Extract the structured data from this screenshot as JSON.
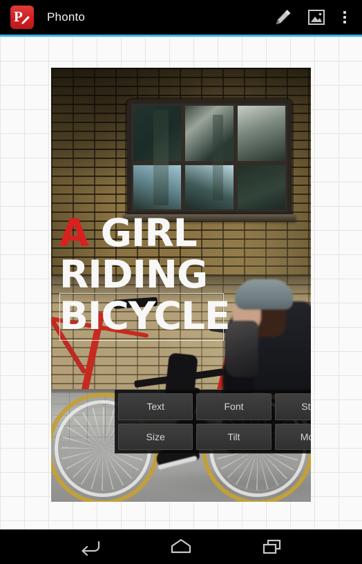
{
  "app": {
    "name": "Phonto",
    "icon_name": "phonto-app-icon",
    "icon_color": "#cf2020"
  },
  "appbar": {
    "title": "Phonto",
    "accent_color": "#33b5e5",
    "background_color": "#000000",
    "actions": [
      {
        "name": "edit-text-icon",
        "label": "Edit"
      },
      {
        "name": "image-icon",
        "label": "Image"
      },
      {
        "name": "overflow-menu-icon",
        "label": "More options"
      }
    ]
  },
  "canvas": {
    "grid_color": "#e4e4e4",
    "background_color": "#fafafa",
    "grid_cell_px": "35"
  },
  "photo": {
    "description": "Woman in dark coat walking past a brick wall with a red bicycle; blurred bicycle in foreground",
    "alt": "brick-wall-cyclist-photo"
  },
  "overlay_text": {
    "line1_accent": "A",
    "line1_rest": " GIRL",
    "line2": "RIDING",
    "line3": "BICYCLE",
    "accent_color": "#d8201f",
    "text_color": "#f7f7f7",
    "selected_line": "BICYCLE"
  },
  "toolbar": {
    "buttons": [
      {
        "name": "text-button",
        "label": "Text"
      },
      {
        "name": "font-button",
        "label": "Font"
      },
      {
        "name": "style-button",
        "label": "Style"
      },
      {
        "name": "size-button",
        "label": "Size"
      },
      {
        "name": "tilt-button",
        "label": "Tilt"
      },
      {
        "name": "move-button",
        "label": "Move"
      }
    ]
  },
  "navbar": {
    "buttons": [
      {
        "name": "back-button",
        "label": "Back"
      },
      {
        "name": "home-button",
        "label": "Home"
      },
      {
        "name": "recents-button",
        "label": "Recent apps"
      }
    ]
  }
}
